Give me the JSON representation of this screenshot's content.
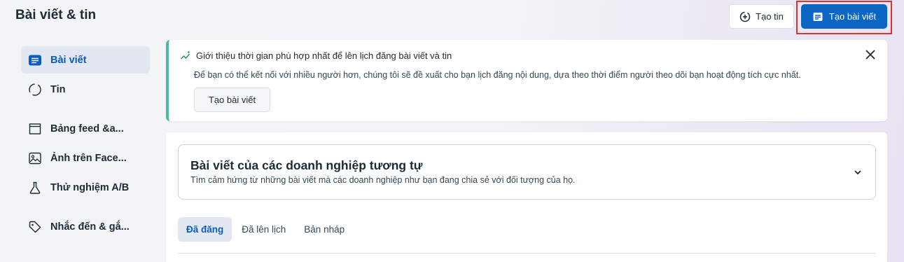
{
  "header": {
    "title": "Bài viết & tin",
    "create_story_label": "Tạo tin",
    "create_post_label": "Tạo bài viết"
  },
  "sidebar": {
    "items": [
      {
        "label": "Bài viết",
        "icon": "post-icon",
        "active": true
      },
      {
        "label": "Tin",
        "icon": "story-circle-icon",
        "active": false
      },
      {
        "label": "Bảng feed &a...",
        "icon": "feed-grid-icon",
        "active": false
      },
      {
        "label": "Ảnh trên Face...",
        "icon": "photo-icon",
        "active": false
      },
      {
        "label": "Thử nghiệm A/B",
        "icon": "flask-icon",
        "active": false
      },
      {
        "label": "Nhắc đến & gắ...",
        "icon": "tag-icon",
        "active": false
      }
    ]
  },
  "banner": {
    "title": "Giới thiệu thời gian phù hợp nhất để lên lịch đăng bài viết và tin",
    "description": "Để bạn có thể kết nối với nhiều người hơn, chúng tôi sẽ đề xuất cho bạn lịch đăng nội dung, dựa theo thời điểm người theo dõi bạn hoạt động tích cực nhất.",
    "button_label": "Tạo bài viết",
    "accent_color": "#4bb8a1"
  },
  "similar": {
    "title": "Bài viết của các doanh nghiệp tương tự",
    "description": "Tìm cảm hứng từ những bài viết mà các doanh nghiệp như bạn đang chia sẻ với đối tượng của họ."
  },
  "tabs": [
    {
      "label": "Đã đăng",
      "active": true
    },
    {
      "label": "Đã lên lịch",
      "active": false
    },
    {
      "label": "Bản nháp",
      "active": false
    }
  ],
  "colors": {
    "primary": "#0a66c2",
    "highlight_border": "#e03131"
  }
}
